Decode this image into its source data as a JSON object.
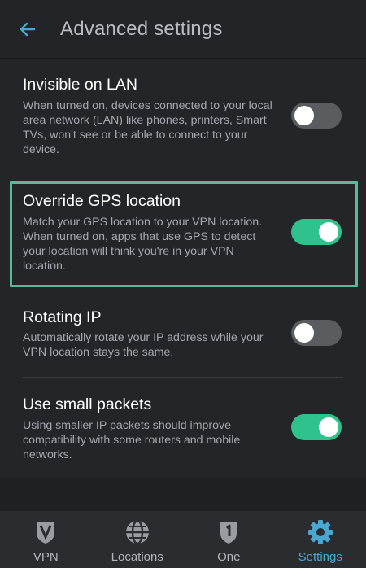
{
  "header": {
    "title": "Advanced settings",
    "back_icon": "arrow-left-icon",
    "accent": "#4aa7cf"
  },
  "settings": [
    {
      "title": "Invisible on LAN",
      "description": "When turned on, devices connected to your local area network (LAN) like phones, printers, Smart TVs, won't see or be able to connect to your device.",
      "enabled": false
    },
    {
      "title": "Override GPS location",
      "description": "Match your GPS location to your VPN location. When turned on, apps that use GPS to detect your location will think you're in your VPN location.",
      "enabled": true,
      "highlighted": true
    },
    {
      "title": "Rotating IP",
      "description": "Automatically rotate your IP address while your VPN location stays the same.",
      "enabled": false
    },
    {
      "title": "Use small packets",
      "description": "Using smaller IP packets should improve compatibility with some routers and mobile networks.",
      "enabled": true
    }
  ],
  "colors": {
    "toggle_on": "#2fc28c",
    "toggle_off": "#5a5c60",
    "highlight_border": "#5bb89a"
  },
  "nav": {
    "items": [
      {
        "label": "VPN",
        "icon": "shield-icon",
        "active": false
      },
      {
        "label": "Locations",
        "icon": "globe-icon",
        "active": false
      },
      {
        "label": "One",
        "icon": "shield-one-icon",
        "active": false
      },
      {
        "label": "Settings",
        "icon": "gear-icon",
        "active": true
      }
    ]
  }
}
